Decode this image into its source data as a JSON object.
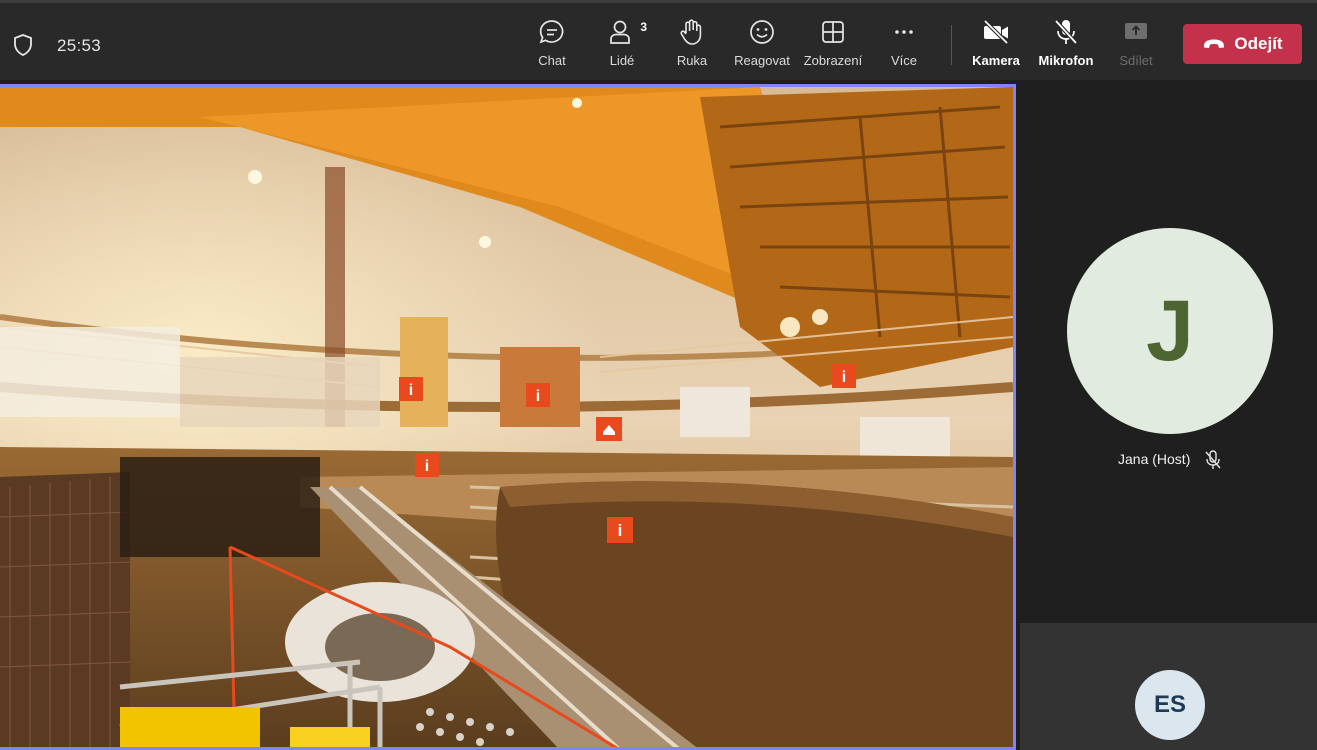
{
  "meeting": {
    "timer": "25:53"
  },
  "toolbar": {
    "chat": "Chat",
    "people": "Lidé",
    "people_count": "3",
    "raise_hand": "Ruka",
    "react": "Reagovat",
    "view": "Zobrazení",
    "more": "Více",
    "camera": "Kamera",
    "mic": "Mikrofon",
    "share": "Sdílet",
    "leave": "Odejít"
  },
  "participants": [
    {
      "initials": "J",
      "name": "Jana (Host)",
      "muted": true,
      "avatar_color": "#e2ebdf",
      "initials_color": "#4c6533"
    },
    {
      "initials": "ES",
      "avatar_color": "#dbe6ef",
      "initials_color": "#1e3b55"
    }
  ],
  "colors": {
    "leave_button": "#c4314b",
    "active_speaker_border": "#7f85f5",
    "hotspot": "#e8491d"
  },
  "icons": [
    "shield-icon",
    "chat-icon",
    "people-icon",
    "hand-icon",
    "smiley-icon",
    "grid-view-icon",
    "more-icon",
    "camera-off-icon",
    "mic-off-icon",
    "share-icon",
    "phone-hangup-icon",
    "info-hotspot-icon",
    "arrow-hotspot-icon"
  ]
}
